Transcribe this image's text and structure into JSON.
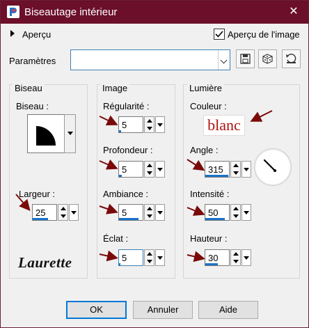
{
  "window": {
    "title": "Biseautage intérieur",
    "close_glyph": "✕"
  },
  "preview": {
    "label": "Aperçu",
    "image_preview_label": "Aperçu de l'image",
    "image_preview_checked": true
  },
  "settings": {
    "label": "Paramètres",
    "preset_value": "",
    "tool_icons": [
      "save-icon",
      "random-die-icon",
      "reset-icon"
    ]
  },
  "bevel": {
    "group_title": "Biseau",
    "bevel_label": "Biseau :",
    "width_label": "Largeur :",
    "width_value": "25",
    "logo_text": "Laurette"
  },
  "image": {
    "group_title": "Image",
    "smoothness_label": "Régularité :",
    "smoothness_value": "5",
    "depth_label": "Profondeur :",
    "depth_value": "5",
    "ambience_label": "Ambiance :",
    "ambience_value": "5",
    "shininess_label": "Éclat :",
    "shininess_value": "5"
  },
  "light": {
    "group_title": "Lumière",
    "color_label": "Couleur :",
    "color_text": "blanc",
    "color_text_color": "#b01010",
    "angle_label": "Angle :",
    "angle_value": "315",
    "intensity_label": "Intensité :",
    "intensity_value": "50",
    "elevation_label": "Hauteur :",
    "elevation_value": "30"
  },
  "buttons": {
    "ok": "OK",
    "cancel": "Annuler",
    "help": "Aide"
  },
  "colors": {
    "titlebar": "#6b0f2b",
    "annotation_arrow": "#7a0a0a",
    "accent": "#1a73c9"
  }
}
